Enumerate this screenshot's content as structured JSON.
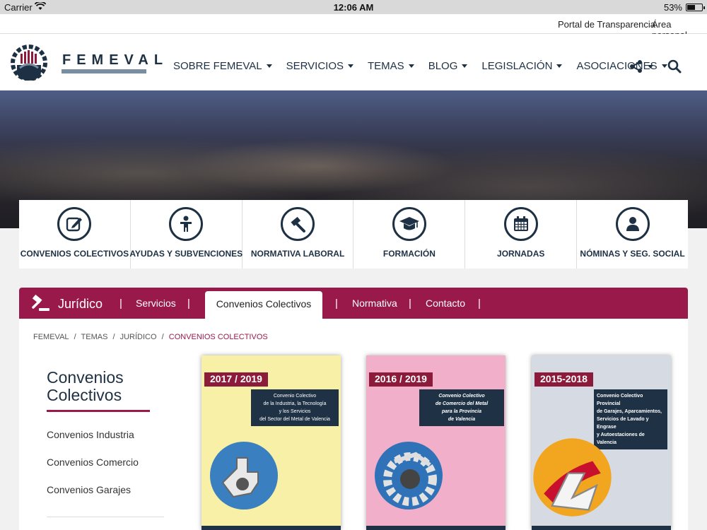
{
  "status_bar": {
    "carrier": "Carrier",
    "time": "12:06 AM",
    "battery": "53%",
    "battery_level": 0.53
  },
  "utility_links": [
    "Portal de Transparencia",
    "Área personal"
  ],
  "logo": {
    "text": "FEMEVAL"
  },
  "nav": [
    {
      "label": "SOBRE FEMEVAL"
    },
    {
      "label": "SERVICIOS"
    },
    {
      "label": "TEMAS"
    },
    {
      "label": "BLOG"
    },
    {
      "label": "LEGISLACIÓN"
    },
    {
      "label": "ASOCIACIONES"
    }
  ],
  "features": [
    {
      "label": "CONVENIOS COLECTIVOS",
      "icon": "edit-icon"
    },
    {
      "label": "AYUDAS Y SUBVENCIONES",
      "icon": "person-icon"
    },
    {
      "label": "NORMATIVA LABORAL",
      "icon": "gavel-icon"
    },
    {
      "label": "FORMACIÓN",
      "icon": "graduation-cap-icon"
    },
    {
      "label": "JORNADAS",
      "icon": "calendar-icon"
    },
    {
      "label": "NÓMINAS Y SEG. SOCIAL",
      "icon": "user-icon"
    }
  ],
  "section": {
    "title": "Jurídico",
    "tabs": [
      "Servicios",
      "Convenios Colectivos",
      "Normativa",
      "Contacto"
    ],
    "active_tab": "Convenios Colectivos"
  },
  "breadcrumb": [
    "FEMEVAL",
    "TEMAS",
    "JURÍDICO",
    "CONVENIOS COLECTIVOS"
  ],
  "sidebar": {
    "title_line1": "Convenios",
    "title_line2": "Colectivos",
    "links": [
      "Convenios Industria",
      "Convenios Comercio",
      "Convenios Garajes"
    ]
  },
  "covers": [
    {
      "year": "2017 / 2019",
      "line1": "Convenio Colectivo",
      "line2": "de la Industria, la Tecnología",
      "line3": "y los Servicios",
      "line4": "del Sector del Metal de Valencia",
      "bg": "#f7f0a6"
    },
    {
      "year": "2016 / 2019",
      "line1": "Convenio Colectivo",
      "line2": "de Comercio del Metal",
      "line3": "para la Provincia",
      "line4": "de Valencia",
      "bg": "#f2afc9"
    },
    {
      "year": "2015-2018",
      "line1": "Convenio Colectivo Provincial",
      "line2": "de Garajes, Aparcamientos,",
      "line3": "Servicios de Lavado y Engrase",
      "line4": "y Autoestaciones de Valencia",
      "bg": "#d6dbe3"
    }
  ],
  "colors": {
    "primary": "#99194a",
    "navy": "#1e3144",
    "accent_blue": "#7a8ea2"
  }
}
